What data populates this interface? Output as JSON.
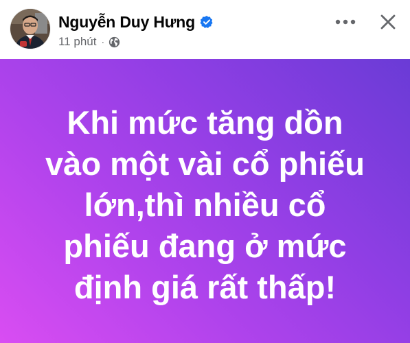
{
  "post": {
    "author": {
      "name": "Nguyễn Duy Hưng",
      "verified": true,
      "avatar_icon": "profile-photo"
    },
    "meta": {
      "time": "11 phút",
      "separator": "·",
      "audience_icon": "globe-icon"
    },
    "actions": {
      "more_icon": "more-dots-icon",
      "close_icon": "close-icon"
    },
    "text": "Khi mức tăng dồn\nvào một vài cổ phiếu\nlớn,thì nhiều cổ\nphiếu đang ở mức\nđịnh giá rất thấp!",
    "background": {
      "gradient_start": "#d94df2",
      "gradient_end": "#6a3bd6"
    }
  },
  "colors": {
    "text_primary": "#050505",
    "text_secondary": "#65676b",
    "verified_blue": "#1877f2"
  }
}
